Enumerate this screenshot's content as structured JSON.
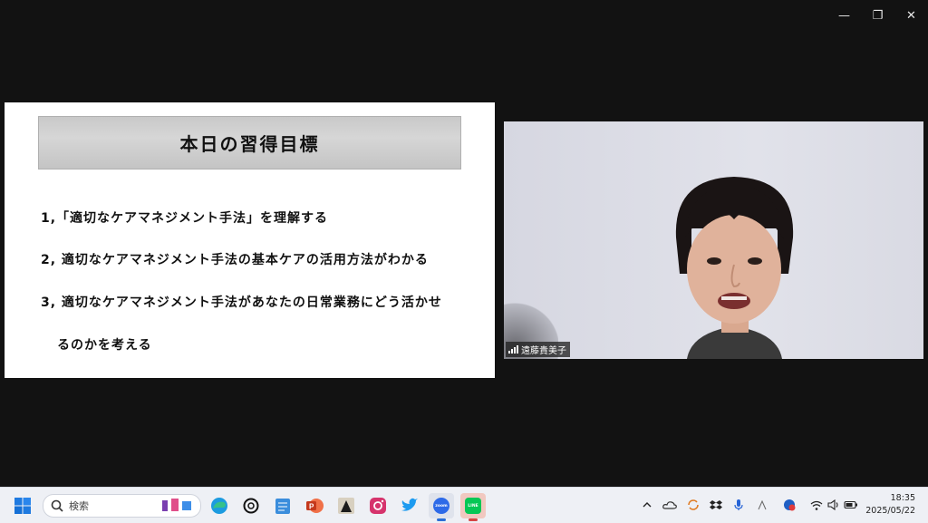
{
  "window_controls": {
    "minimize": "—",
    "restore": "❐",
    "close": "✕"
  },
  "slide": {
    "title": "本日の習得目標",
    "goals": [
      "1,「適切なケアマネジメント手法」を理解する",
      "2, 適切なケアマネジメント手法の基本ケアの活用方法がわかる",
      "3, 適切なケアマネジメント手法があなたの日常業務にどう活かせ",
      "るのかを考える"
    ]
  },
  "video": {
    "participant_name": "遠藤貴美子"
  },
  "taskbar": {
    "search_placeholder": "検索",
    "apps": [
      "windows-start",
      "edge",
      "chatgpt",
      "notepad",
      "powerpoint",
      "app",
      "instagram",
      "twitter",
      "zoom",
      "line"
    ],
    "zoom_label": "zoom",
    "line_label": "LINE",
    "clock_time": "18:35",
    "clock_date": "2025/05/22"
  }
}
